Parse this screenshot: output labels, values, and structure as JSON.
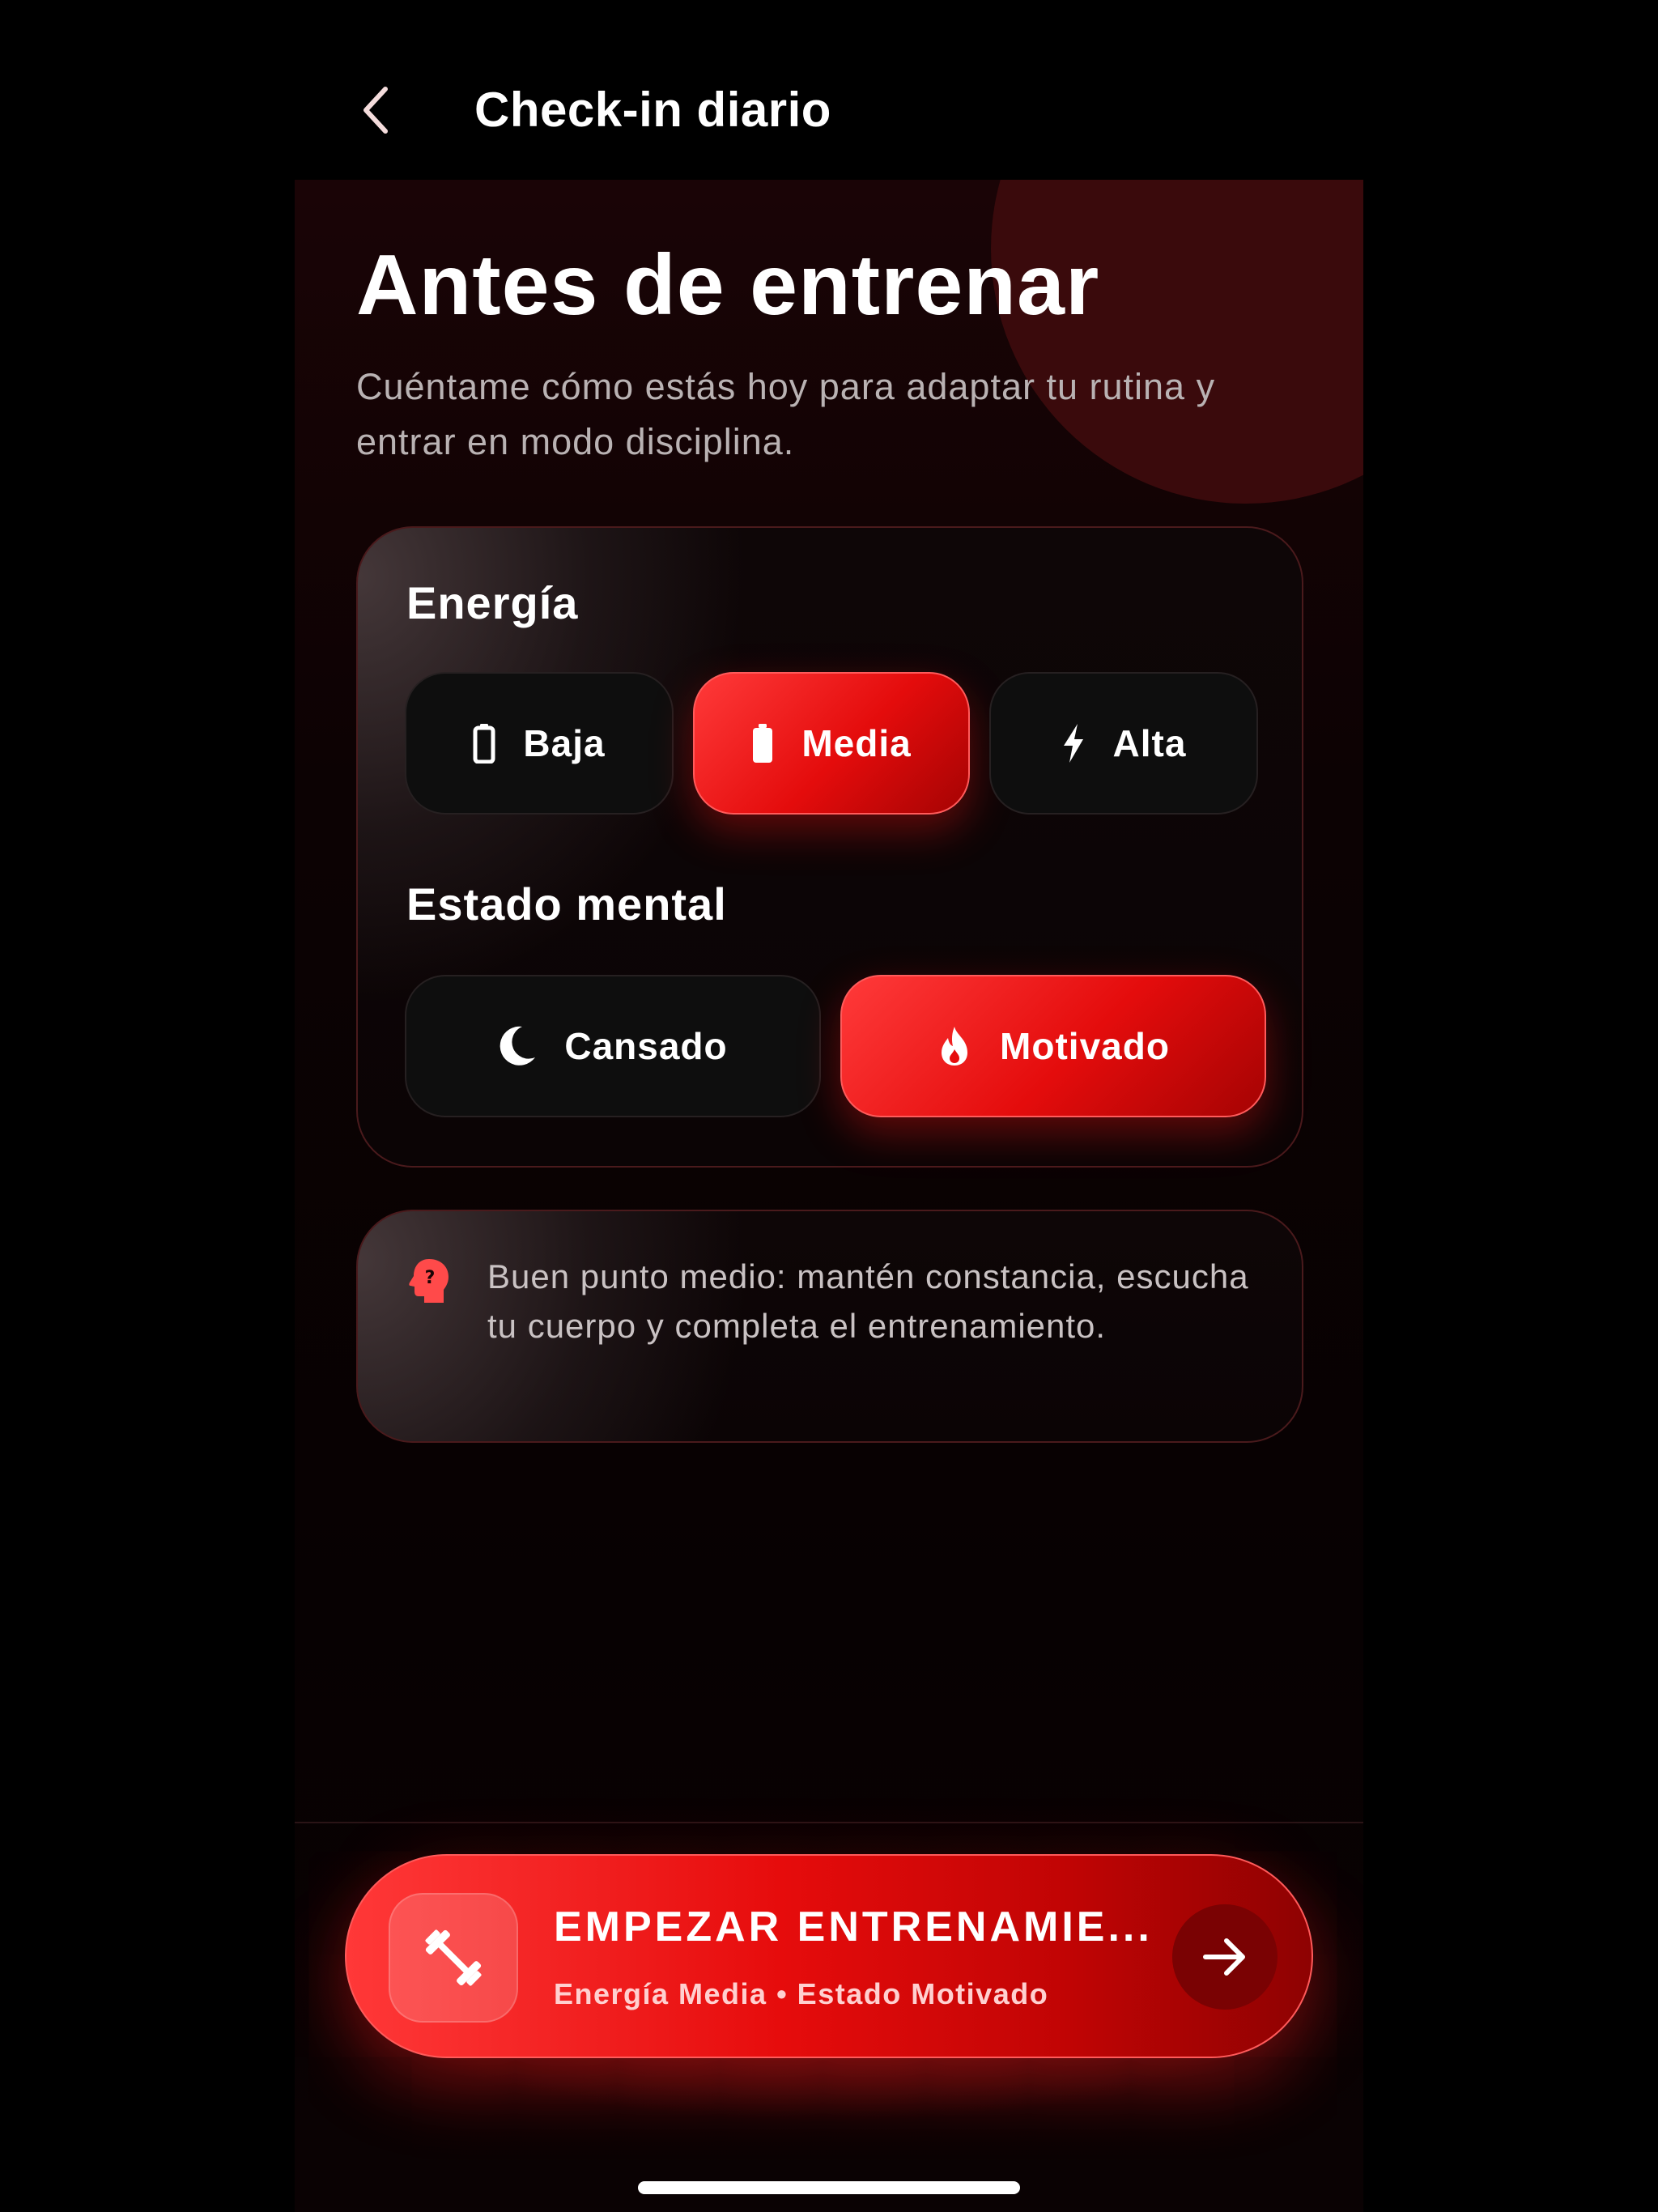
{
  "nav": {
    "title": "Check-in diario",
    "back_icon": "chevron-left-icon"
  },
  "header": {
    "title": "Antes de entrenar",
    "subtitle": "Cuéntame cómo estás hoy para adaptar tu rutina y entrar en modo disciplina."
  },
  "energy": {
    "label": "Energía",
    "options": [
      {
        "label": "Baja",
        "icon": "battery-low-icon",
        "selected": false
      },
      {
        "label": "Media",
        "icon": "battery-medium-icon",
        "selected": true
      },
      {
        "label": "Alta",
        "icon": "bolt-icon",
        "selected": false
      }
    ]
  },
  "mental": {
    "label": "Estado mental",
    "options": [
      {
        "label": "Cansado",
        "icon": "moon-icon",
        "selected": false
      },
      {
        "label": "Motivado",
        "icon": "flame-icon",
        "selected": true
      }
    ]
  },
  "tip": {
    "icon": "head-question-icon",
    "text": "Buen punto medio: mantén constancia, escucha tu cuerpo y completa el entrenamiento."
  },
  "cta": {
    "title": "EMPEZAR ENTRENAMIE...",
    "subtitle": "Energía Media • Estado Motivado",
    "icon": "dumbbell-icon",
    "arrow_icon": "arrow-right-icon"
  },
  "colors": {
    "accent": "#E60C0C",
    "background": "#000000",
    "card_border": "#4A1A1C"
  }
}
